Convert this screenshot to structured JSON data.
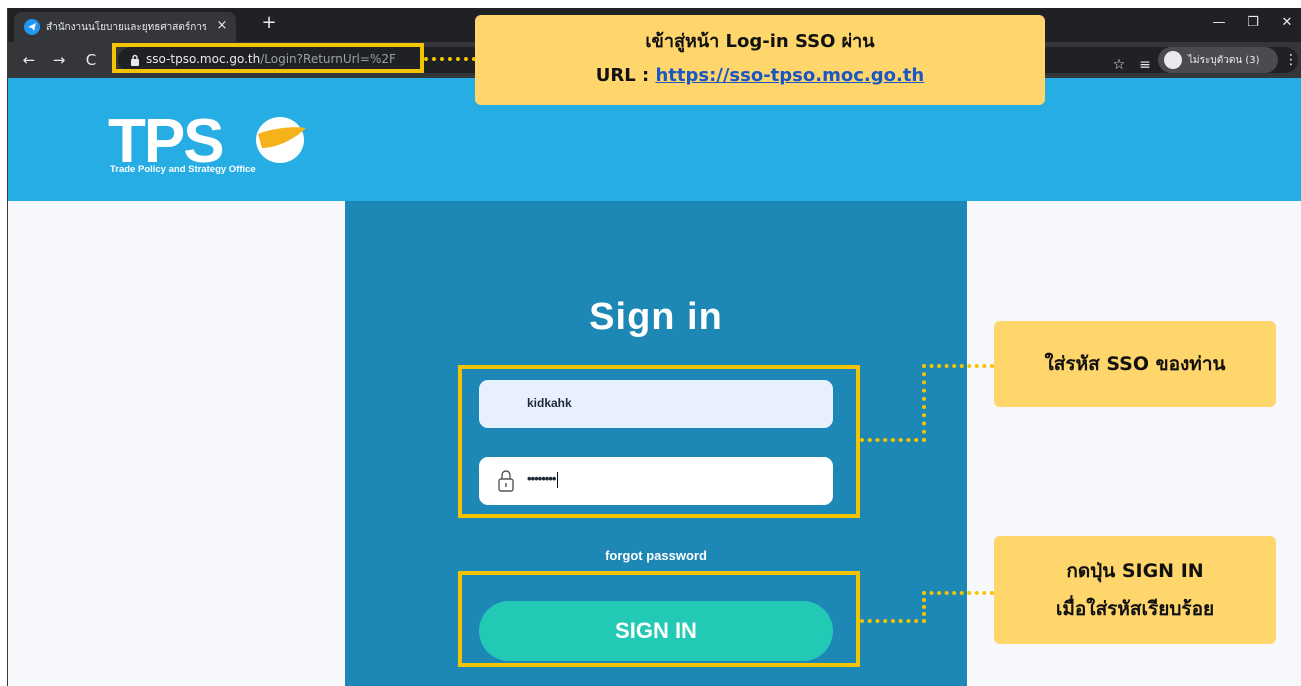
{
  "browser": {
    "tab_title": "สำนักงานนโยบายและยุทธศาสตร์การค้า",
    "tab_close": "×",
    "new_tab": "+",
    "minimize": "—",
    "restore": "❐",
    "close": "✕",
    "back": "←",
    "forward": "→",
    "reload": "C",
    "url_host": "sso-tpso.moc.go.th",
    "url_path": "/Login?ReturnUrl=%2F",
    "star": "☆",
    "media": "≡",
    "profile_label": "ไม่ระบุตัวตน (3)",
    "menu": "⋮"
  },
  "header": {
    "logo_text": "TPS",
    "logo_tagline": "Trade Policy and Strategy Office",
    "brand_color": "#26aee4"
  },
  "login": {
    "title": "Sign in",
    "username_value": "kidkahk",
    "password_value": "••••••••",
    "forgot_label": "forgot password",
    "signin_label": "SIGN IN",
    "panel_color": "#1d87b5",
    "button_color": "#22c9b5"
  },
  "annotations": {
    "top_line1": "เข้าสู่หน้า Log-in SSO ผ่าน",
    "top_line2_prefix": "URL : ",
    "top_line2_link": "https://sso-tpso.moc.go.th",
    "right1": "ใส่รหัส SSO ของท่าน",
    "right2_line1": "กดปุ่น SIGN IN",
    "right2_line2": "เมื่อใส่รหัสเรียบร้อย",
    "highlight_color": "#f5c400",
    "note_color": "#ffd66b"
  }
}
